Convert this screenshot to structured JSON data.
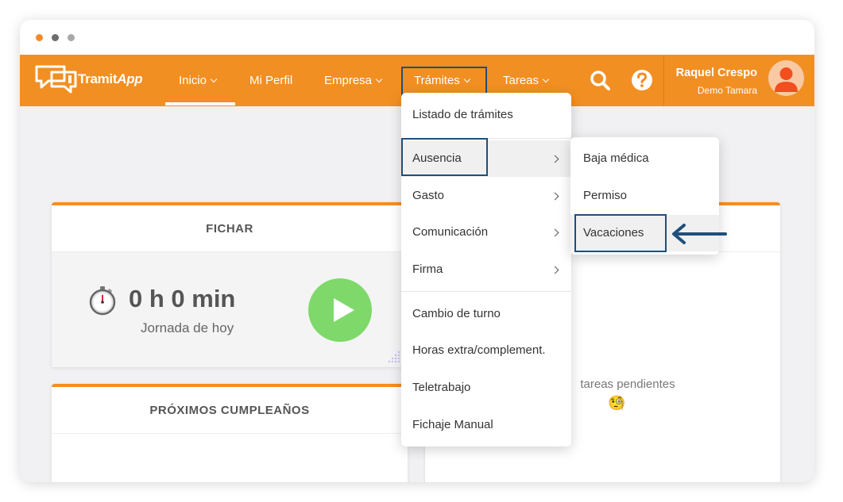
{
  "window": {
    "dots": [
      "#ef8a2a",
      "#6d6d6d",
      "#a8a8a8"
    ]
  },
  "colors": {
    "brand": "#f28f22",
    "highlight_border": "#1f4f7a",
    "play_green": "#7ed96a"
  },
  "logo": {
    "part1": "Tramit",
    "part2": "App"
  },
  "nav": {
    "inicio": "Inicio",
    "mi_perfil": "Mi Perfil",
    "empresa": "Empresa",
    "tramites": "Trámites",
    "tareas": "Tareas",
    "search_icon": "search-icon",
    "help_icon": "help-icon"
  },
  "user": {
    "name": "Raquel Crespo",
    "company": "Demo Tamara"
  },
  "fichar": {
    "title": "FICHAR",
    "time": "0 h 0 min",
    "label": "Jornada de hoy"
  },
  "cumpleanos": {
    "title": "PRÓXIMOS CUMPLEAÑOS"
  },
  "tareas_card": {
    "empty_text": "tareas pendientes",
    "emoji": "🧐"
  },
  "tramites_menu": {
    "items": [
      {
        "label": "Listado de trámites",
        "has_submenu": false
      },
      {
        "label": "Ausencia",
        "has_submenu": true,
        "highlighted": true
      },
      {
        "label": "Gasto",
        "has_submenu": true
      },
      {
        "label": "Comunicación",
        "has_submenu": true
      },
      {
        "label": "Firma",
        "has_submenu": true
      },
      {
        "label": "Cambio de turno",
        "has_submenu": false
      },
      {
        "label": "Horas extra/complement.",
        "has_submenu": false
      },
      {
        "label": "Teletrabajo",
        "has_submenu": false
      },
      {
        "label": "Fichaje Manual",
        "has_submenu": false
      }
    ]
  },
  "ausencia_submenu": {
    "items": [
      {
        "label": "Baja médica"
      },
      {
        "label": "Permiso"
      },
      {
        "label": "Vacaciones",
        "highlighted": true
      }
    ]
  }
}
